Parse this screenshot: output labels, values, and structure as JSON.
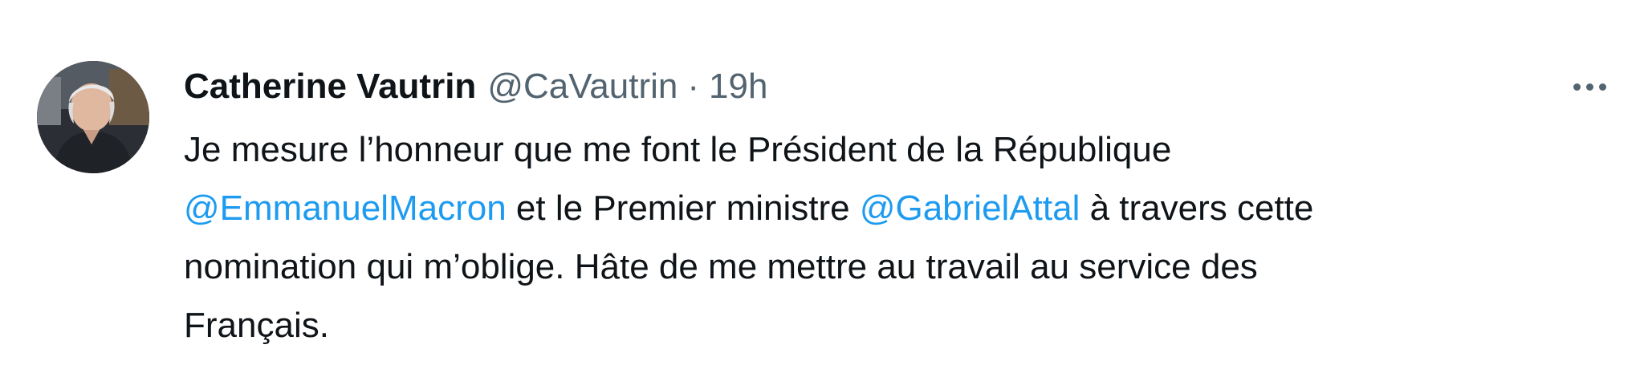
{
  "tweet": {
    "author": {
      "display_name": "Catherine Vautrin",
      "handle": "@CaVautrin",
      "avatar_icon": "profile-photo-avatar"
    },
    "separator": "·",
    "timestamp": "19h",
    "more_icon": "more-horizontal-icon",
    "text": {
      "line1": "Je mesure l’honneur que me font le Président de la République",
      "mention1": "@EmmanuelMacron",
      "line2_middle": " et le Premier ministre ",
      "mention2": "@GabrielAttal",
      "line2_end": " à travers cette",
      "line3": "nomination qui m’oblige. Hâte de me mettre au travail au service des",
      "line4": "Français."
    },
    "colors": {
      "mention": "#1d9bf0",
      "text": "#0f1419",
      "secondary": "#536471"
    }
  }
}
